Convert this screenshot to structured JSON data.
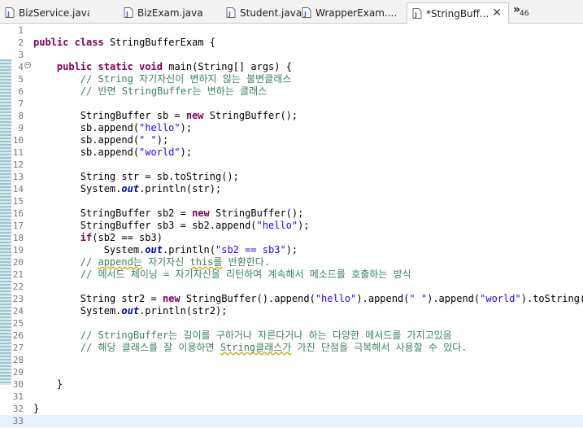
{
  "tabs": [
    {
      "label": "BizService.java",
      "active": false,
      "close": ""
    },
    {
      "label": "BizExam.java",
      "active": false,
      "close": ""
    },
    {
      "label": "Student.java",
      "active": false,
      "close": ""
    },
    {
      "label": "WrapperExam....",
      "active": false,
      "close": ""
    },
    {
      "label": "*StringBuff...",
      "active": true,
      "close": "✕"
    }
  ],
  "overflow": {
    "chevron": "»",
    "count": "46"
  },
  "lines": [
    {
      "n": "1",
      "tokens": []
    },
    {
      "n": "2",
      "tokens": [
        [
          "kw",
          "public"
        ],
        [
          "",
          " "
        ],
        [
          "kw",
          "class"
        ],
        [
          "",
          " StringBufferExam {"
        ]
      ]
    },
    {
      "n": "3",
      "tokens": []
    },
    {
      "n": "4",
      "fold": true,
      "tokens": [
        [
          "",
          "    "
        ],
        [
          "kw",
          "public"
        ],
        [
          "",
          " "
        ],
        [
          "kw",
          "static"
        ],
        [
          "",
          " "
        ],
        [
          "kw",
          "void"
        ],
        [
          "",
          " main(String[] args) {"
        ]
      ]
    },
    {
      "n": "5",
      "tokens": [
        [
          "",
          "        "
        ],
        [
          "cm",
          "// String 자기자신이 변하지 않는 불변클래스"
        ]
      ]
    },
    {
      "n": "6",
      "tokens": [
        [
          "",
          "        "
        ],
        [
          "cm",
          "// 반면 StringBuffer는 변하는 클래스"
        ]
      ]
    },
    {
      "n": "7",
      "tokens": []
    },
    {
      "n": "8",
      "tokens": [
        [
          "",
          "        StringBuffer sb = "
        ],
        [
          "kw",
          "new"
        ],
        [
          "",
          " StringBuffer();"
        ]
      ]
    },
    {
      "n": "9",
      "tokens": [
        [
          "",
          "        sb.append("
        ],
        [
          "str",
          "\"hello\""
        ],
        [
          "",
          ");"
        ]
      ]
    },
    {
      "n": "10",
      "tokens": [
        [
          "",
          "        sb.append("
        ],
        [
          "str",
          "\" \""
        ],
        [
          "",
          ");"
        ]
      ]
    },
    {
      "n": "11",
      "tokens": [
        [
          "",
          "        sb.append("
        ],
        [
          "str",
          "\"world\""
        ],
        [
          "",
          ");"
        ]
      ]
    },
    {
      "n": "12",
      "tokens": []
    },
    {
      "n": "13",
      "tokens": [
        [
          "",
          "        String str = sb.toString();"
        ]
      ]
    },
    {
      "n": "14",
      "tokens": [
        [
          "",
          "        System."
        ],
        [
          "fld",
          "out"
        ],
        [
          "",
          ".println(str);"
        ]
      ]
    },
    {
      "n": "15",
      "tokens": []
    },
    {
      "n": "16",
      "tokens": [
        [
          "",
          "        StringBuffer sb2 = "
        ],
        [
          "kw",
          "new"
        ],
        [
          "",
          " StringBuffer();"
        ]
      ]
    },
    {
      "n": "17",
      "tokens": [
        [
          "",
          "        StringBuffer sb3 = sb2.append("
        ],
        [
          "str",
          "\"hello\""
        ],
        [
          "",
          ");"
        ]
      ]
    },
    {
      "n": "18",
      "tokens": [
        [
          "",
          "        "
        ],
        [
          "kw",
          "if"
        ],
        [
          "",
          "(sb2 == sb3)"
        ]
      ]
    },
    {
      "n": "19",
      "tokens": [
        [
          "",
          "            System."
        ],
        [
          "fld",
          "out"
        ],
        [
          "",
          ".println("
        ],
        [
          "str",
          "\"sb2 == sb3\""
        ],
        [
          "",
          ");"
        ]
      ]
    },
    {
      "n": "20",
      "tokens": [
        [
          "",
          "        "
        ],
        [
          "cm",
          "// "
        ],
        [
          "cm sq",
          "append는"
        ],
        [
          "cm",
          " 자기자신 "
        ],
        [
          "cm sq",
          "this를"
        ],
        [
          "cm",
          " 반환한다."
        ]
      ]
    },
    {
      "n": "21",
      "tokens": [
        [
          "",
          "        "
        ],
        [
          "cm",
          "// 메서드 체이닝 = 자기자신을 리턴하여 계속해서 메소드를 호출하는 방식"
        ]
      ]
    },
    {
      "n": "22",
      "tokens": []
    },
    {
      "n": "23",
      "tokens": [
        [
          "",
          "        String str2 = "
        ],
        [
          "kw",
          "new"
        ],
        [
          "",
          " StringBuffer().append("
        ],
        [
          "str",
          "\"hello\""
        ],
        [
          "",
          ").append("
        ],
        [
          "str",
          "\" \""
        ],
        [
          "",
          ").append("
        ],
        [
          "str",
          "\"world\""
        ],
        [
          "",
          ").toString();"
        ]
      ]
    },
    {
      "n": "24",
      "tokens": [
        [
          "",
          "        System."
        ],
        [
          "fld",
          "out"
        ],
        [
          "",
          ".println(str2);"
        ]
      ]
    },
    {
      "n": "25",
      "tokens": []
    },
    {
      "n": "26",
      "tokens": [
        [
          "",
          "        "
        ],
        [
          "cm",
          "// StringBuffer는 길이를 구하거나 자른다거나 하는 다양한 메서드를 가지고있음"
        ]
      ]
    },
    {
      "n": "27",
      "tokens": [
        [
          "",
          "        "
        ],
        [
          "cm",
          "// 해당 클래스를 잘 이용하면 "
        ],
        [
          "cm sq",
          "String클래스가"
        ],
        [
          "cm",
          " 가진 단점을 극복해서 사용할 수 있다."
        ]
      ]
    },
    {
      "n": "28",
      "tokens": []
    },
    {
      "n": "29",
      "tokens": []
    },
    {
      "n": "30",
      "tokens": [
        [
          "",
          "    }"
        ]
      ]
    },
    {
      "n": "31",
      "tokens": []
    },
    {
      "n": "32",
      "tokens": [
        [
          "",
          "}"
        ]
      ]
    },
    {
      "n": "33",
      "tokens": [],
      "current": true
    }
  ]
}
